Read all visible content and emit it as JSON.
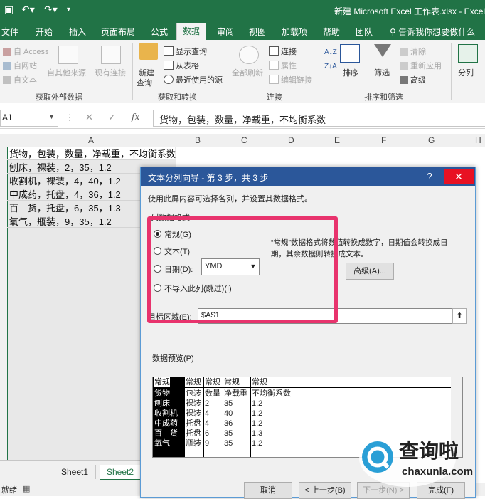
{
  "app": {
    "window_title": "新建 Microsoft Excel 工作表.xlsx - Excel",
    "tabs": [
      "文件",
      "开始",
      "插入",
      "页面布局",
      "公式",
      "数据",
      "审阅",
      "视图",
      "加载项",
      "帮助",
      "团队"
    ],
    "active_tab": "数据",
    "tell_me": "告诉我你想要做什么"
  },
  "ribbon": {
    "get_external": {
      "access": "自 Access",
      "web": "自网站",
      "text": "自文本",
      "other": "自其他来源",
      "existing": "现有连接",
      "group": "获取外部数据"
    },
    "get_transform": {
      "new_query_1": "新建",
      "new_query_2": "查询",
      "show_query": "显示查询",
      "from_table": "从表格",
      "recent_sources": "最近使用的源",
      "group": "获取和转换"
    },
    "connections": {
      "refresh_all": "全部刷新",
      "connections": "连接",
      "properties": "属性",
      "edit_links": "编辑链接",
      "group": "连接"
    },
    "sort_filter": {
      "sort": "排序",
      "filter": "筛选",
      "clear": "清除",
      "reapply": "重新应用",
      "advanced": "高级",
      "group": "排序和筛选"
    },
    "split": {
      "label": "分列"
    }
  },
  "formula_bar": {
    "name_box": "A1",
    "content": "货物，包装，数量，净载重，不均衡系数",
    "fx": "fx"
  },
  "grid": {
    "columns": [
      "A",
      "B",
      "C",
      "D",
      "E",
      "F",
      "G",
      "H"
    ],
    "cells": [
      "货物，包装，数量，净载重，不均衡系数",
      "刨床，裸装，2，35，1.2",
      "收割机，裸装，4，40，1.2",
      "中成药，托盘，4，36，1.2",
      "百　货，托盘，6，35，1.3",
      "氧气，瓶装，9，35，1.2"
    ]
  },
  "sheets": {
    "tabs": [
      "Sheet1",
      "Sheet2"
    ],
    "active": "Sheet2"
  },
  "status": {
    "ready": "就绪"
  },
  "dialog": {
    "title": "文本分列向导 - 第 3 步，共 3 步",
    "help": "?",
    "close": "✕",
    "description": "使用此屏内容可选择各列，并设置其数据格式。",
    "format_label": "列数据格式",
    "options": [
      "常规(G)",
      "文本(T)",
      "日期(D):",
      "不导入此列(跳过)(I)"
    ],
    "selected_option": "常规(G)",
    "date_format": "YMD",
    "general_note_1": "“常规”数据格式将数值转换成数字，日期值会转换成日",
    "general_note_2": "期，其余数据则转换成文本。",
    "advanced_button": "高级(A)...",
    "destination_label": "目标区域(E):",
    "destination_value": "$A$1",
    "preview_label": "数据预览(P)",
    "preview_header": [
      "常规",
      "常规",
      "常规",
      "常规",
      "常规"
    ],
    "preview_rows": [
      [
        "货物",
        "包装",
        "数量",
        "净载重",
        "不均衡系数"
      ],
      [
        "刨床",
        "裸装",
        "2",
        "35",
        "1.2"
      ],
      [
        "收割机",
        "裸装",
        "4",
        "40",
        "1.2"
      ],
      [
        "中成药",
        "托盘",
        "4",
        "36",
        "1.2"
      ],
      [
        "百　货",
        "托盘",
        "6",
        "35",
        "1.3"
      ],
      [
        "氧气",
        "瓶装",
        "9",
        "35",
        "1.2"
      ]
    ],
    "buttons": {
      "cancel": "取消",
      "back": "< 上一步(B)",
      "next": "下一步(N) >",
      "finish": "完成(F)"
    }
  },
  "watermark": {
    "name": "查询啦",
    "domain": "chaxunla.com"
  },
  "colors": {
    "excel_green": "#217346",
    "dialog_blue": "#2b579a",
    "highlight_pink": "#e8336d",
    "close_red": "#e81123"
  }
}
